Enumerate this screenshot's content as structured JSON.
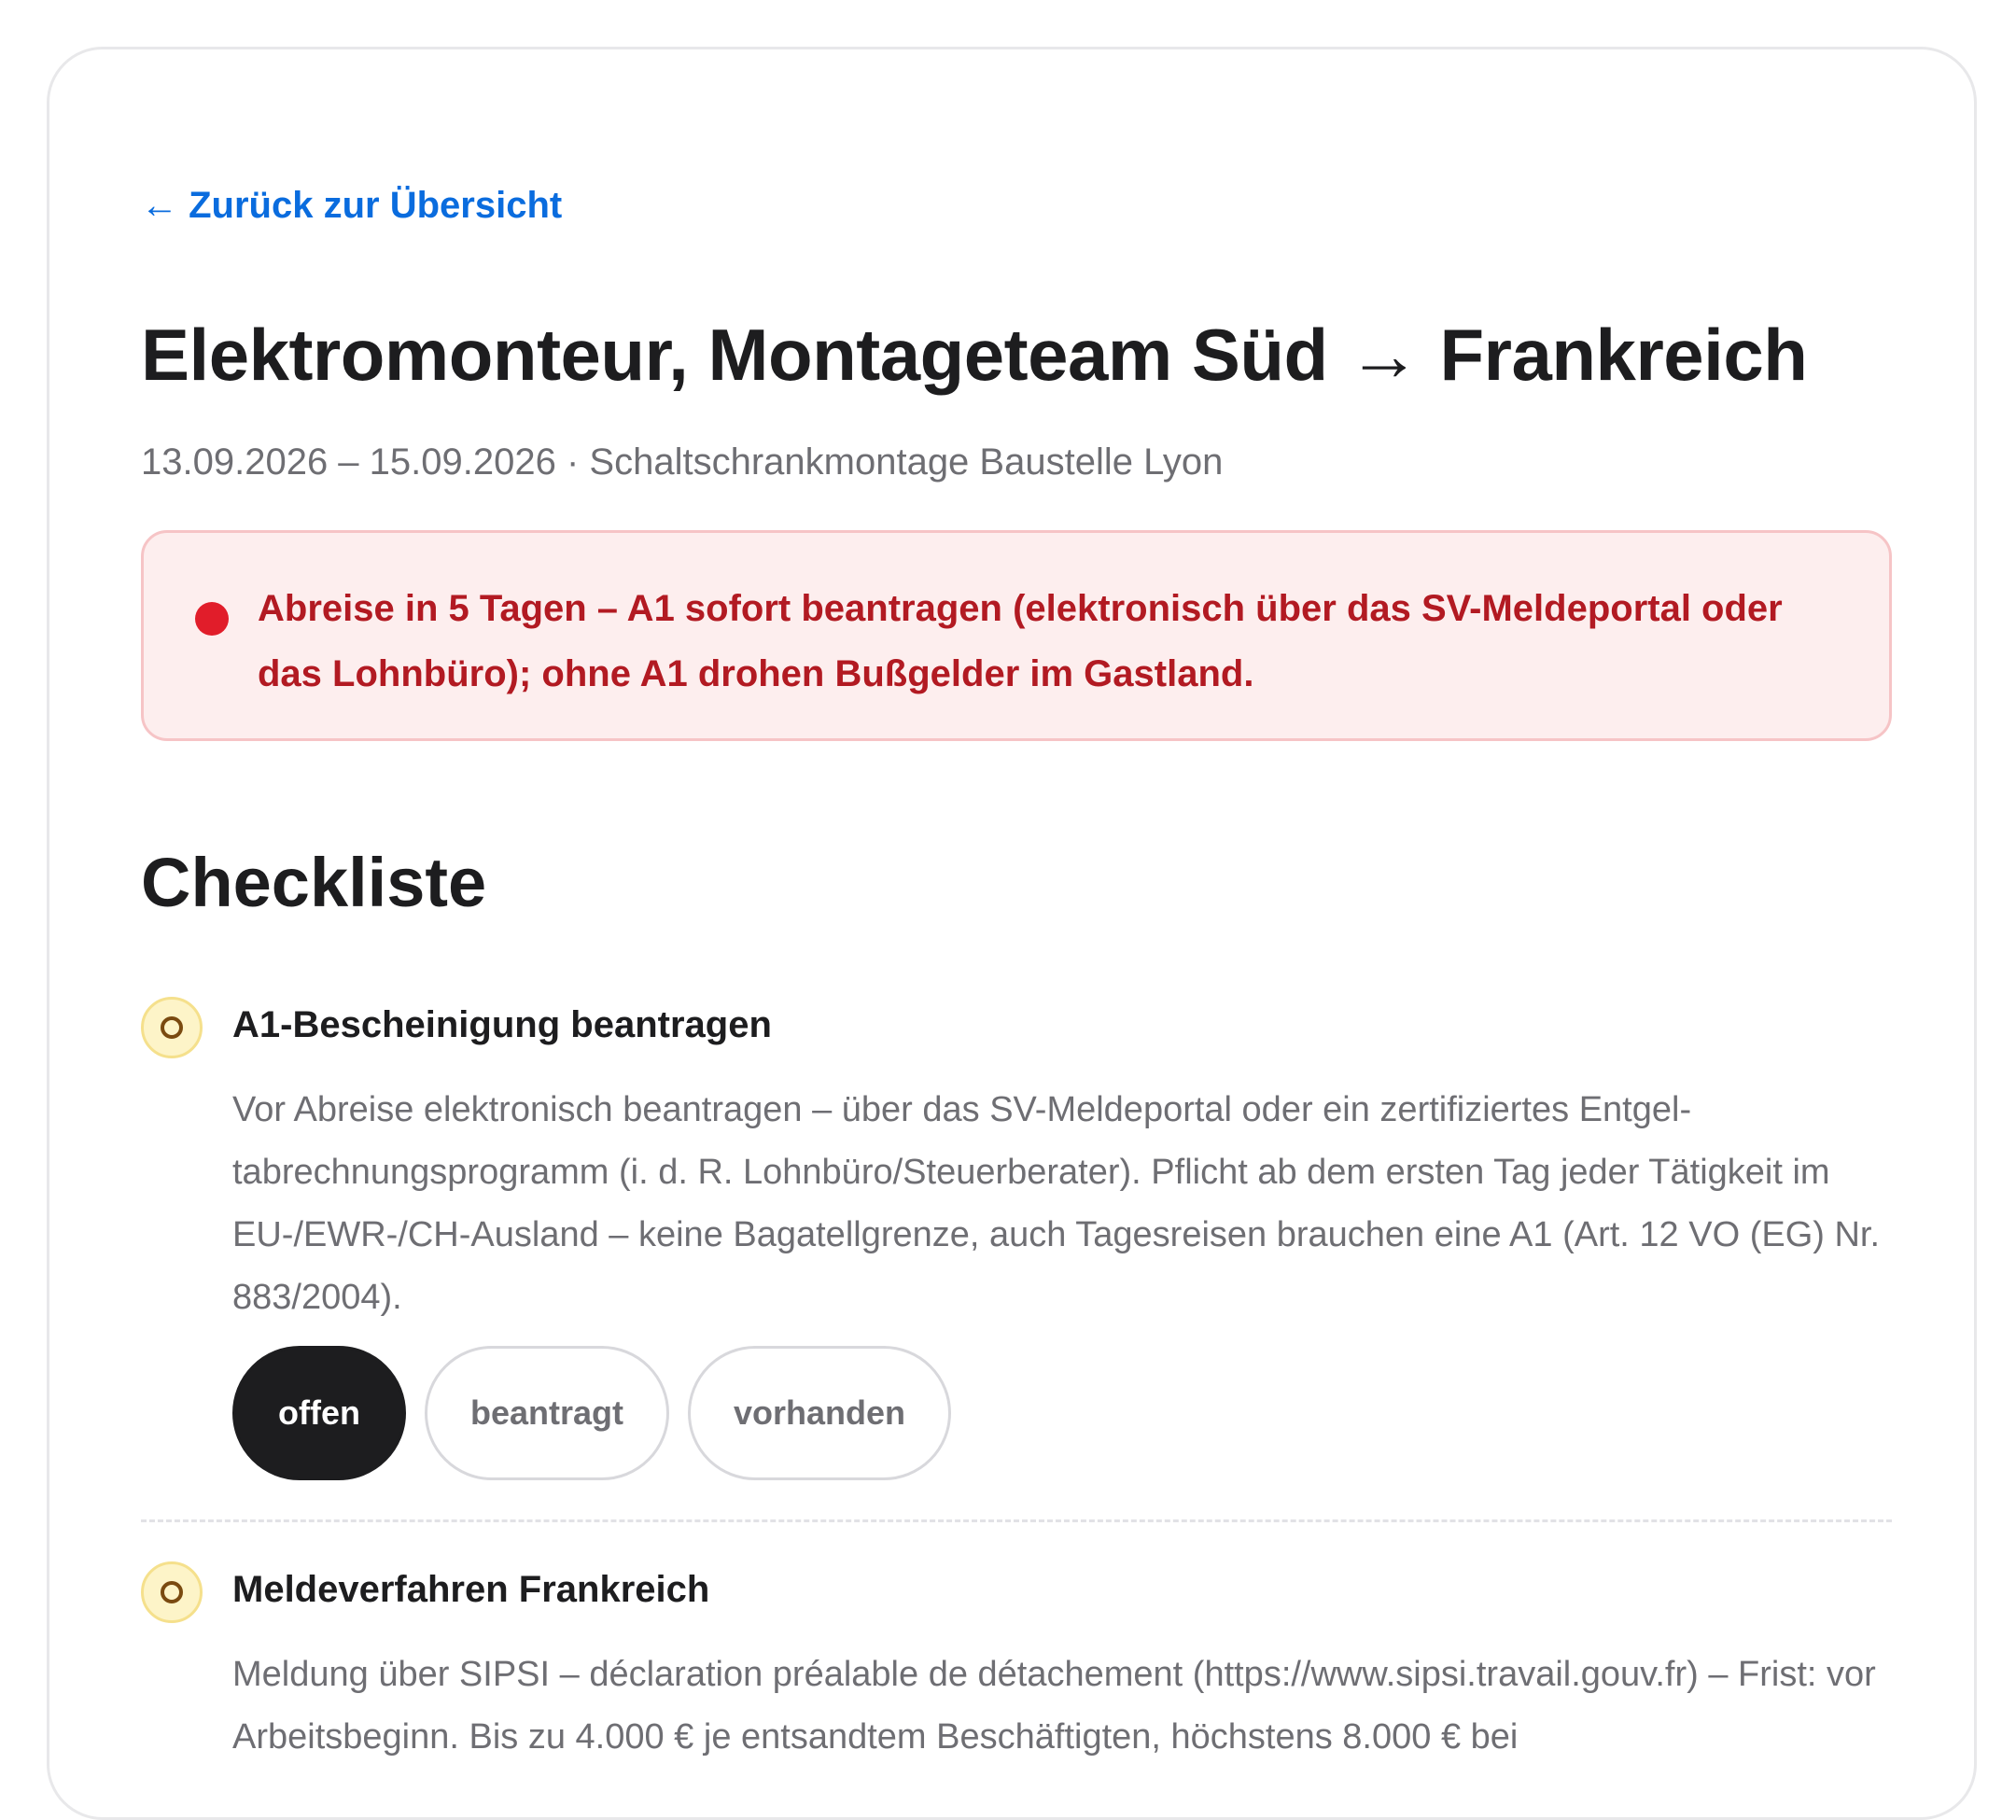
{
  "nav": {
    "back_label": "← Zurück zur Übersicht"
  },
  "header": {
    "title": "Elektromonteur, Montageteam Süd → Frankreich",
    "subtitle": "13.09.2026 – 15.09.2026 · Schaltschrankmontage Baustelle Lyon"
  },
  "alert": {
    "text": "Abreise in 5 Tagen – A1 sofort beantragen (elektronisch über das SV-Meldeportal oder das Lohnbüro); ohne A1 drohen Bußgelder im Gastland.",
    "color": "#e11d2a"
  },
  "checklist": {
    "title": "Checkliste",
    "items": [
      {
        "title": "A1-Bescheinigung beantragen",
        "description": "Vor Abreise elektronisch beantragen – über das SV-Meldeportal oder ein zertifiziertes Entgel­tabrechnungsprogramm (i. d. R. Lohnbüro/Steuerberater). Pflicht ab dem ersten Tag jeder Tätigkeit im EU-/EWR-/CH-Ausland – keine Bagatellgrenze, auch Tagesreisen brauchen eine A1 (Art. 12 VO (EG) Nr. 883/2004).",
        "status_icon": "open-circle-icon",
        "statuses": [
          "offen",
          "beantragt",
          "vorhanden"
        ],
        "selected_status": "offen"
      },
      {
        "title": "Meldeverfahren Frankreich",
        "description": "Meldung über SIPSI – déclaration préalable de détachement (https://www.sipsi.travail.gouv.fr) – Frist: vor Arbeitsbeginn. Bis zu 4.000 € je entsandtem Beschäftigten, höchstens 8.000 € bei",
        "status_icon": "open-circle-icon"
      }
    ]
  },
  "colors": {
    "link": "#0a6cde",
    "alert_text": "#b21a22",
    "alert_background": "#fdeeee",
    "active_button": "#1d1d1f",
    "status_pending": "#fdf4c8"
  }
}
